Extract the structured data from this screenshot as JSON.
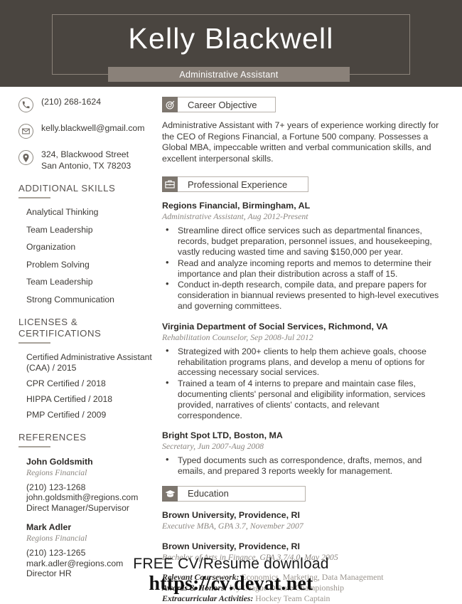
{
  "header": {
    "name": "Kelly Blackwell",
    "job_title": "Administrative Assistant",
    "band_color": "#8a8179",
    "background_color": "#4a4540"
  },
  "sidebar": {
    "contact": [
      {
        "icon": "phone-icon",
        "line1": "(210) 268-1624",
        "line2": ""
      },
      {
        "icon": "envelope-icon",
        "line1": "kelly.blackwell@gmail.com",
        "line2": ""
      },
      {
        "icon": "location-pin-icon",
        "line1": "324, Blackwood Street",
        "line2": "San Antonio, TX 78203"
      }
    ],
    "skills_heading": "ADDITIONAL SKILLS",
    "skills": [
      "Analytical Thinking",
      "Team Leadership",
      "Organization",
      "Problem Solving",
      "Team Leadership",
      "Strong Communication"
    ],
    "licenses_heading": "LICENSES & CERTIFICATIONS",
    "licenses": [
      "Certified Administrative Assistant (CAA) / 2015",
      "CPR Certified / 2018",
      "HIPPA Certified / 2018",
      "PMP Certified / 2009"
    ],
    "references_heading": "REFERENCES",
    "references": [
      {
        "name": "John Goldsmith",
        "company": "Regions Financial",
        "phone": "(210) 123-1268",
        "email": "john.goldsmith@regions.com",
        "relation": "Direct Manager/Supervisor"
      },
      {
        "name": "Mark Adler",
        "company": "Regions Financial",
        "phone": "(210) 123-1265",
        "email": "mark.adler@regions.com",
        "relation": "Director HR"
      }
    ]
  },
  "main": {
    "objective": {
      "icon": "target-icon",
      "heading": "Career Objective",
      "text": "Administrative Assistant with 7+ years of experience working directly for the CEO of Regions Financial, a Fortune 500 company. Possesses a Global MBA, impeccable written and verbal communication skills, and excellent interpersonal skills."
    },
    "experience": {
      "icon": "briefcase-icon",
      "heading": "Professional Experience",
      "jobs": [
        {
          "title": "Regions Financial, Birmingham, AL",
          "subtitle": "Administrative Assistant, Aug 2012-Present",
          "bullets": [
            "Streamline direct office services such as departmental finances, records, budget preparation, personnel issues, and housekeeping, vastly reducing wasted time and saving $150,000 per year.",
            "Read and analyze incoming reports and memos to determine their importance and plan their distribution across a staff of 15.",
            "Conduct in-depth research, compile data, and prepare papers for consideration in biannual reviews presented to high-level executives and governing committees."
          ]
        },
        {
          "title": "Virginia Department of Social Services, Richmond, VA",
          "subtitle": "Rehabilitation Counselor, Sep 2008-Jul 2012",
          "bullets": [
            "Strategized with 200+ clients to help them achieve goals, choose rehabilitation programs plans, and develop a menu of options for accessing necessary social services.",
            "Trained a team of 4 interns to prepare and maintain case files, documenting clients' personal and eligibility information, services provided, narratives of clients' contacts, and relevant correspondence."
          ]
        },
        {
          "title": "Bright Spot LTD, Boston, MA",
          "subtitle": "Secretary, Jun 2007-Aug 2008",
          "bullets": [
            "Typed documents such as correspondence, drafts, memos, and emails, and prepared 3 reports weekly for management."
          ]
        }
      ]
    },
    "education": {
      "icon": "graduation-cap-icon",
      "heading": "Education",
      "schools": [
        {
          "title": "Brown University, Providence, RI",
          "subtitle": "Executive MBA, GPA 3.7, November 2007"
        },
        {
          "title": "Brown University, Providence, RI",
          "subtitle": "Bachelor of Arts in Finance, GPA 3.7/4.0, May 2005"
        }
      ],
      "extras": [
        {
          "label": "Relevant Coursework:",
          "value": " Economics, Marketing, Data Management"
        },
        {
          "label": "Awards & Honors:",
          "value": " Ivy League Debate Championship"
        },
        {
          "label": "Extracurricular Activities:",
          "value": " Hockey Team Captain"
        }
      ]
    }
  },
  "watermark": {
    "line1": "FREE CV/Resume download",
    "line2": "https://cv.devat.net"
  }
}
